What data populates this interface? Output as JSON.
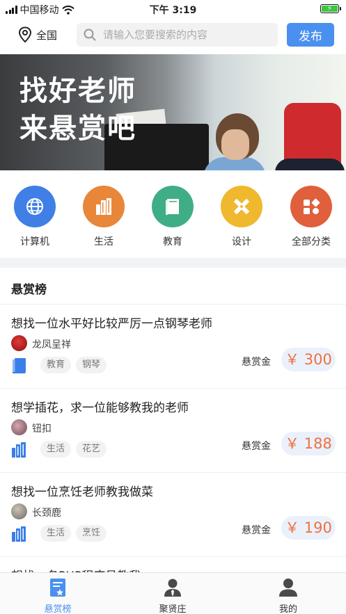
{
  "status_bar": {
    "carrier": "中国移动",
    "time": "下午 3:19"
  },
  "header": {
    "location": "全国",
    "search_placeholder": "请输入您要搜索的内容",
    "publish_label": "发布"
  },
  "banner": {
    "line1": "找好老师",
    "line2": "来悬赏吧"
  },
  "categories": [
    {
      "label": "计算机",
      "icon": "globe-icon",
      "color": "#3f7fe6"
    },
    {
      "label": "生活",
      "icon": "buildings-icon",
      "color": "#e8863a"
    },
    {
      "label": "教育",
      "icon": "book-icon",
      "color": "#3fae86"
    },
    {
      "label": "设计",
      "icon": "design-tools-icon",
      "color": "#f0b82e"
    },
    {
      "label": "全部分类",
      "icon": "grid-shapes-icon",
      "color": "#e05f3c"
    }
  ],
  "section_title": "悬赏榜",
  "reward_label": "悬赏金",
  "bounties": [
    {
      "title": "想找一位水平好比较严厉一点钢琴老师",
      "user": "龙凤呈祥",
      "tags": [
        "教育",
        "钢琴"
      ],
      "reward": "￥ 300",
      "category_icon": "book-icon"
    },
    {
      "title": "想学插花，求一位能够教我的老师",
      "user": "钮扣",
      "tags": [
        "生活",
        "花艺"
      ],
      "reward": "￥ 188",
      "category_icon": "buildings-icon"
    },
    {
      "title": "想找一位烹饪老师教我做菜",
      "user": "长颈鹿",
      "tags": [
        "生活",
        "烹饪"
      ],
      "reward": "￥ 190",
      "category_icon": "buildings-icon"
    },
    {
      "title": "想找一名PHP程序员教我"
    }
  ],
  "tabs": [
    {
      "label": "悬赏榜",
      "icon": "bounty-board-icon",
      "active": true
    },
    {
      "label": "聚贤庄",
      "icon": "person-tie-icon",
      "active": false
    },
    {
      "label": "我的",
      "icon": "user-icon",
      "active": false
    }
  ],
  "colors": {
    "accent": "#4a90f0",
    "reward": "#f07040"
  }
}
